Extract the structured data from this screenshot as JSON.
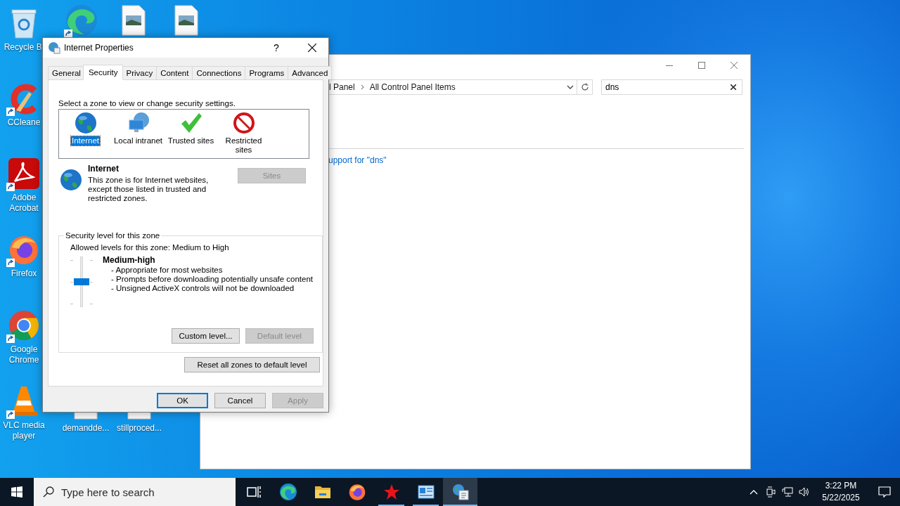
{
  "desktop_icons": [
    {
      "kind": "recycle",
      "label": "Recycle Bi",
      "shortcut": false
    },
    {
      "kind": "ccleaner",
      "label": "CCleane",
      "shortcut": true
    },
    {
      "kind": "acrobat",
      "label": "Adobe Acrobat",
      "shortcut": true
    },
    {
      "kind": "firefox",
      "label": "Firefox",
      "shortcut": true
    },
    {
      "kind": "chrome",
      "label": "Google Chrome",
      "shortcut": true
    },
    {
      "kind": "vlc",
      "label": "VLC media player",
      "shortcut": true
    },
    {
      "kind": "edge",
      "shortcut": true
    },
    {
      "kind": "image-file",
      "shortcut": false
    },
    {
      "kind": "image-file",
      "shortcut": false
    },
    {
      "kind": "image-file",
      "label": "demandde...",
      "shortcut": false
    },
    {
      "kind": "image-file",
      "label": "stillproced...",
      "shortcut": false
    }
  ],
  "background_window": {
    "address_path": [
      "l Panel",
      "All Control Panel Items"
    ],
    "search_value": "dns",
    "link": "upport for \"dns\""
  },
  "dialog": {
    "title": "Internet Properties",
    "help": "?",
    "tabs": [
      {
        "label": "General",
        "selected": false
      },
      {
        "label": "Security",
        "selected": true
      },
      {
        "label": "Privacy",
        "selected": false
      },
      {
        "label": "Content",
        "selected": false
      },
      {
        "label": "Connections",
        "selected": false
      },
      {
        "label": "Programs",
        "selected": false
      },
      {
        "label": "Advanced",
        "selected": false
      }
    ],
    "zone_prompt": "Select a zone to view or change security settings.",
    "zones": [
      {
        "kind": "internet",
        "label": "Internet",
        "selected": true
      },
      {
        "kind": "intranet",
        "label": "Local intranet",
        "selected": false
      },
      {
        "kind": "trusted",
        "label": "Trusted sites",
        "selected": false
      },
      {
        "kind": "restricted",
        "label": "Restricted sites",
        "selected": false
      }
    ],
    "zone_title": "Internet",
    "zone_description": "This zone is for Internet websites, except those listed in trusted and restricted zones.",
    "sites_button": {
      "label": "Sites",
      "disabled": true
    },
    "security_group": {
      "legend": "Security level for this zone",
      "allowed": "Allowed levels for this zone: Medium to High",
      "level": 0.5,
      "level_name": "Medium-high",
      "bullets": [
        "- Appropriate for most websites",
        "- Prompts before downloading potentially unsafe content",
        "- Unsigned ActiveX controls will not be downloaded"
      ],
      "buttons": [
        {
          "label": "Custom level...",
          "disabled": false
        },
        {
          "label": "Default level",
          "disabled": true
        }
      ]
    },
    "reset_button": {
      "label": "Reset all zones to default level",
      "disabled": false
    },
    "buttons": [
      {
        "label": "OK",
        "disabled": false,
        "default": true
      },
      {
        "label": "Cancel",
        "disabled": false,
        "default": false
      },
      {
        "label": "Apply",
        "disabled": true,
        "default": false
      }
    ]
  },
  "taskbar": {
    "search_placeholder": "Type here to search",
    "apps": [
      {
        "kind": "task-view",
        "selected": false,
        "running": false
      },
      {
        "kind": "edge",
        "selected": false,
        "running": false
      },
      {
        "kind": "explorer",
        "selected": false,
        "running": false
      },
      {
        "kind": "firefox",
        "selected": false,
        "running": false
      },
      {
        "kind": "star",
        "selected": false,
        "running": true
      },
      {
        "kind": "control-panel",
        "selected": false,
        "running": true
      },
      {
        "kind": "internet-options",
        "selected": true,
        "running": true
      }
    ],
    "time": "3:22 PM",
    "date": "5/22/2025"
  }
}
